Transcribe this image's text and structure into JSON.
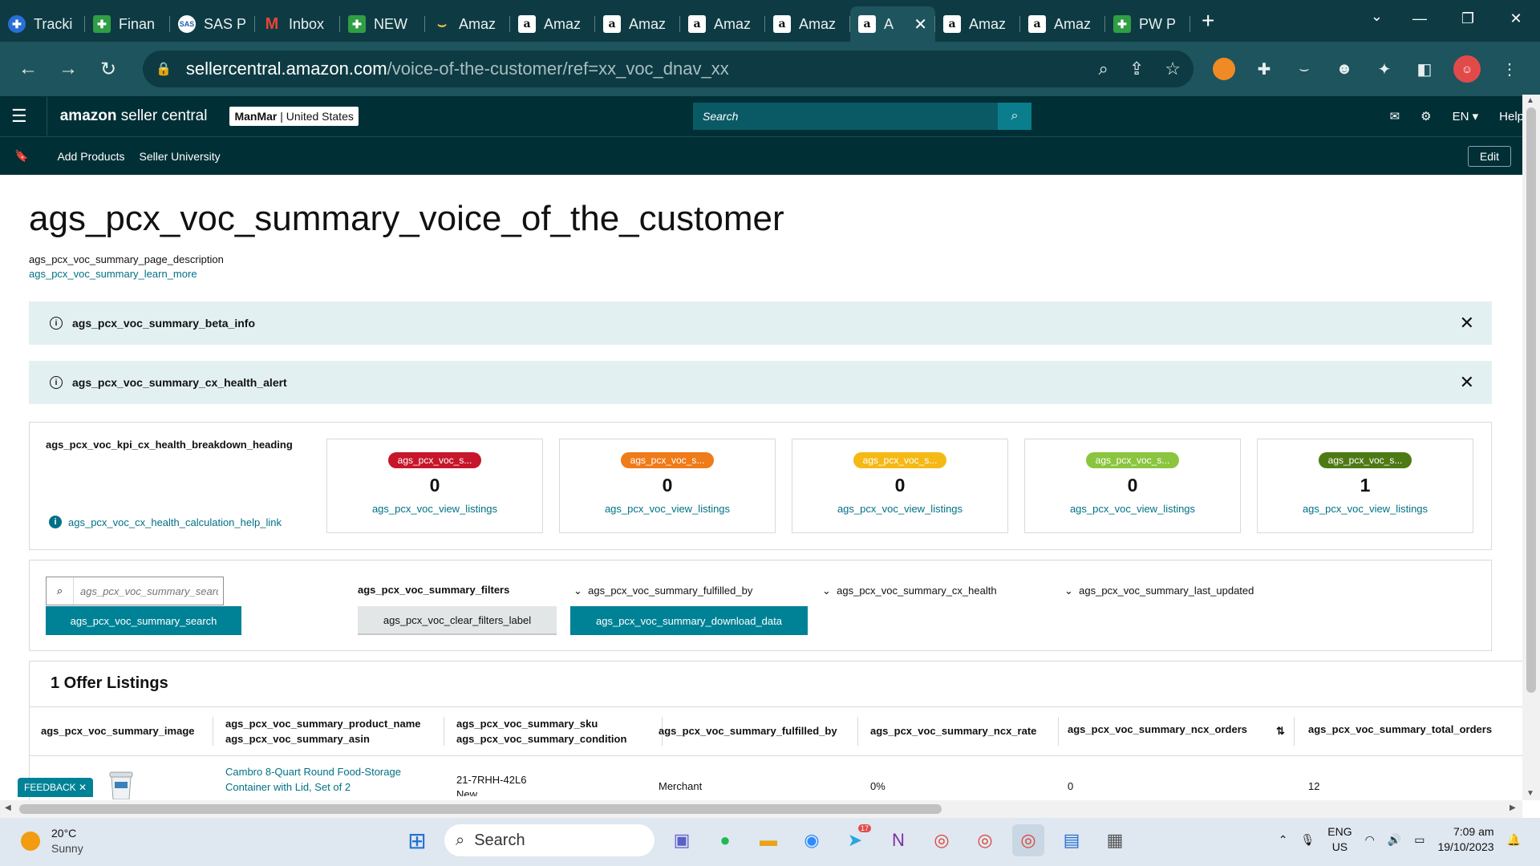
{
  "browser": {
    "tabs": [
      {
        "label": "Tracki",
        "icon": "blue-cross-icon"
      },
      {
        "label": "Finan",
        "icon": "green-plus-icon"
      },
      {
        "label": "SAS P",
        "icon": "sas-icon"
      },
      {
        "label": "Inbox",
        "icon": "gmail-icon"
      },
      {
        "label": "NEW",
        "icon": "green-plus-icon"
      },
      {
        "label": "Amaz",
        "icon": "dark-amazon-icon"
      },
      {
        "label": "Amaz",
        "icon": "amazon-icon"
      },
      {
        "label": "Amaz",
        "icon": "amazon-icon"
      },
      {
        "label": "Amaz",
        "icon": "amazon-icon"
      },
      {
        "label": "Amaz",
        "icon": "amazon-icon"
      },
      {
        "label": "A",
        "icon": "amazon-icon",
        "active": true
      },
      {
        "label": "Amaz",
        "icon": "amazon-icon"
      },
      {
        "label": "Amaz",
        "icon": "amazon-icon"
      },
      {
        "label": "PW P",
        "icon": "green-plus-icon"
      }
    ],
    "url_host": "sellercentral.amazon.com",
    "url_path": "/voice-of-the-customer/ref=xx_voc_dnav_xx"
  },
  "header": {
    "logo_bold": "amazon",
    "logo_rest": " seller central",
    "account_name": "ManMar",
    "account_region": " | United States",
    "search_placeholder": "Search",
    "language": "EN",
    "help": "Help",
    "nav": [
      "Add Products",
      "Seller University"
    ],
    "edit": "Edit"
  },
  "page": {
    "title": "ags_pcx_voc_summary_voice_of_the_customer",
    "description": "ags_pcx_voc_summary_page_description",
    "learn_more": "ags_pcx_voc_summary_learn_more",
    "alerts": [
      "ags_pcx_voc_summary_beta_info",
      "ags_pcx_voc_summary_cx_health_alert"
    ]
  },
  "kpi": {
    "heading": "ags_pcx_voc_kpi_cx_health_breakdown_heading",
    "help_link": "ags_pcx_voc_cx_health_calculation_help_link",
    "cards": [
      {
        "pill": "ags_pcx_voc_s...",
        "color": "#c7162b",
        "count": "0",
        "link": "ags_pcx_voc_view_listings"
      },
      {
        "pill": "ags_pcx_voc_s...",
        "color": "#ef7b19",
        "count": "0",
        "link": "ags_pcx_voc_view_listings"
      },
      {
        "pill": "ags_pcx_voc_s...",
        "color": "#f5b916",
        "count": "0",
        "link": "ags_pcx_voc_view_listings"
      },
      {
        "pill": "ags_pcx_voc_s...",
        "color": "#8bc53f",
        "count": "0",
        "link": "ags_pcx_voc_view_listings"
      },
      {
        "pill": "ags_pcx_voc_s...",
        "color": "#4e7a15",
        "count": "1",
        "link": "ags_pcx_voc_view_listings"
      }
    ]
  },
  "filters": {
    "search_placeholder": "ags_pcx_voc_summary_search",
    "search_button": "ags_pcx_voc_summary_search",
    "filters_label": "ags_pcx_voc_summary_filters",
    "clear_filters": "ags_pcx_voc_clear_filters_label",
    "download": "ags_pcx_voc_summary_download_data",
    "dropdowns": [
      "ags_pcx_voc_summary_fulfilled_by",
      "ags_pcx_voc_summary_cx_health",
      "ags_pcx_voc_summary_last_updated"
    ]
  },
  "table": {
    "title": "1 Offer Listings",
    "headers": {
      "image": "ags_pcx_voc_summary_image",
      "product_name": "ags_pcx_voc_summary_product_name",
      "asin": "ags_pcx_voc_summary_asin",
      "sku": "ags_pcx_voc_summary_sku",
      "condition": "ags_pcx_voc_summary_condition",
      "fulfilled_by": "ags_pcx_voc_summary_fulfilled_by",
      "ncx_rate": "ags_pcx_voc_summary_ncx_rate",
      "ncx_orders": "ags_pcx_voc_summary_ncx_orders",
      "total_orders": "ags_pcx_voc_summary_total_orders"
    },
    "rows": [
      {
        "product_name_1": "Cambro 8-Quart Round Food-Storage",
        "product_name_2": "Container with Lid, Set of 2",
        "sku": "21-7RHH-42L6",
        "condition": "New",
        "fulfilled_by": "Merchant",
        "ncx_rate": "0%",
        "ncx_orders": "0",
        "total_orders": "12"
      }
    ]
  },
  "feedback": "FEEDBACK",
  "taskbar": {
    "temp": "20°C",
    "condition": "Sunny",
    "search": "Search",
    "telegram_badge": "17",
    "lang1": "ENG",
    "lang2": "US",
    "time": "7:09 am",
    "date": "19/10/2023"
  }
}
